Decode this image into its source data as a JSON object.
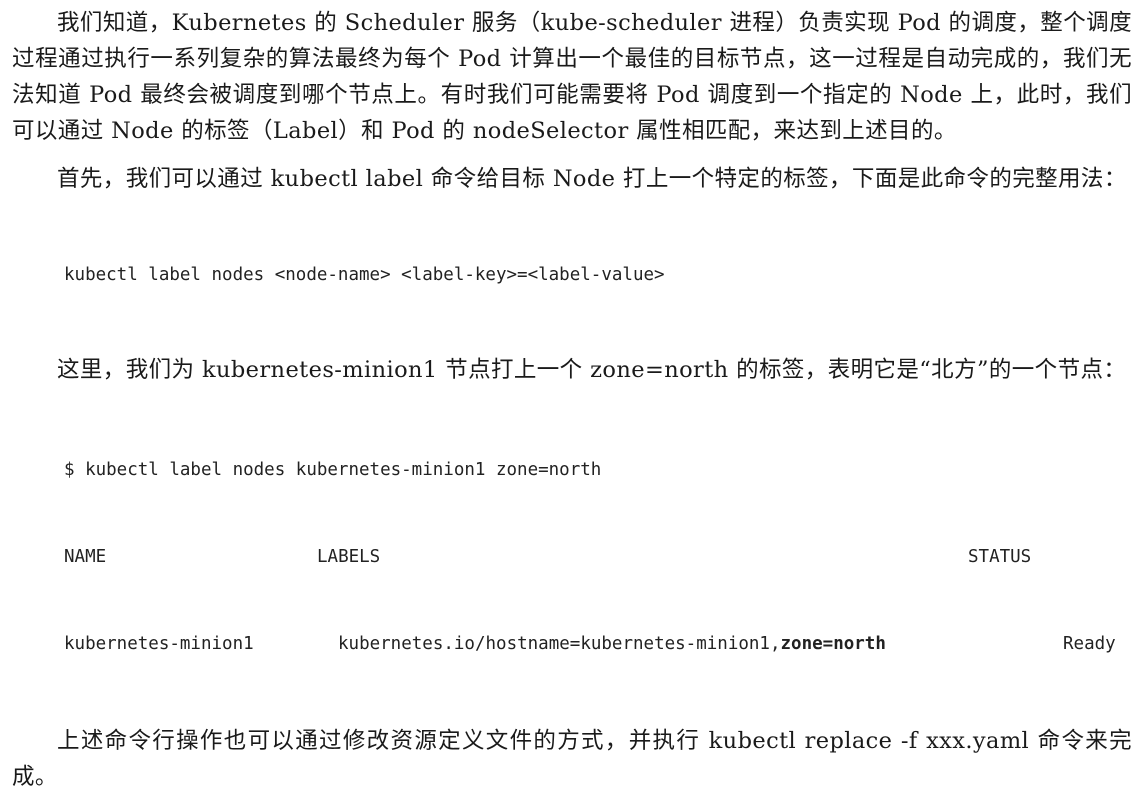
{
  "paragraphs": [
    "我们知道，Kubernetes 的 Scheduler 服务（kube-scheduler 进程）负责实现 Pod 的调度，整个调度过程通过执行一系列复杂的算法最终为每个 Pod 计算出一个最佳的目标节点，这一过程是自动完成的，我们无法知道 Pod 最终会被调度到哪个节点上。有时我们可能需要将 Pod 调度到一个指定的 Node 上，此时，我们可以通过 Node 的标签（Label）和 Pod 的 nodeSelector 属性相匹配，来达到上述目的。",
    "首先，我们可以通过 kubectl label 命令给目标 Node 打上一个特定的标签，下面是此命令的完整用法：",
    "这里，我们为 kubernetes-minion1 节点打上一个 zone=north 的标签，表明它是“北方”的一个节点：",
    "上述命令行操作也可以通过修改资源定义文件的方式，并执行 kubectl replace -f xxx.yaml 命令来完成。"
  ],
  "code_usage": "kubectl label nodes <node-name> <label-key>=<label-value>",
  "code_example": {
    "command": "$ kubectl label nodes kubernetes-minion1 zone=north",
    "headers": {
      "name": "NAME",
      "labels": "LABELS",
      "status": "STATUS"
    },
    "row": {
      "name": "kubernetes-minion1",
      "labels_plain": "kubernetes.io/hostname=kubernetes-minion1,",
      "labels_bold": "zone=north",
      "status": "Ready"
    }
  }
}
